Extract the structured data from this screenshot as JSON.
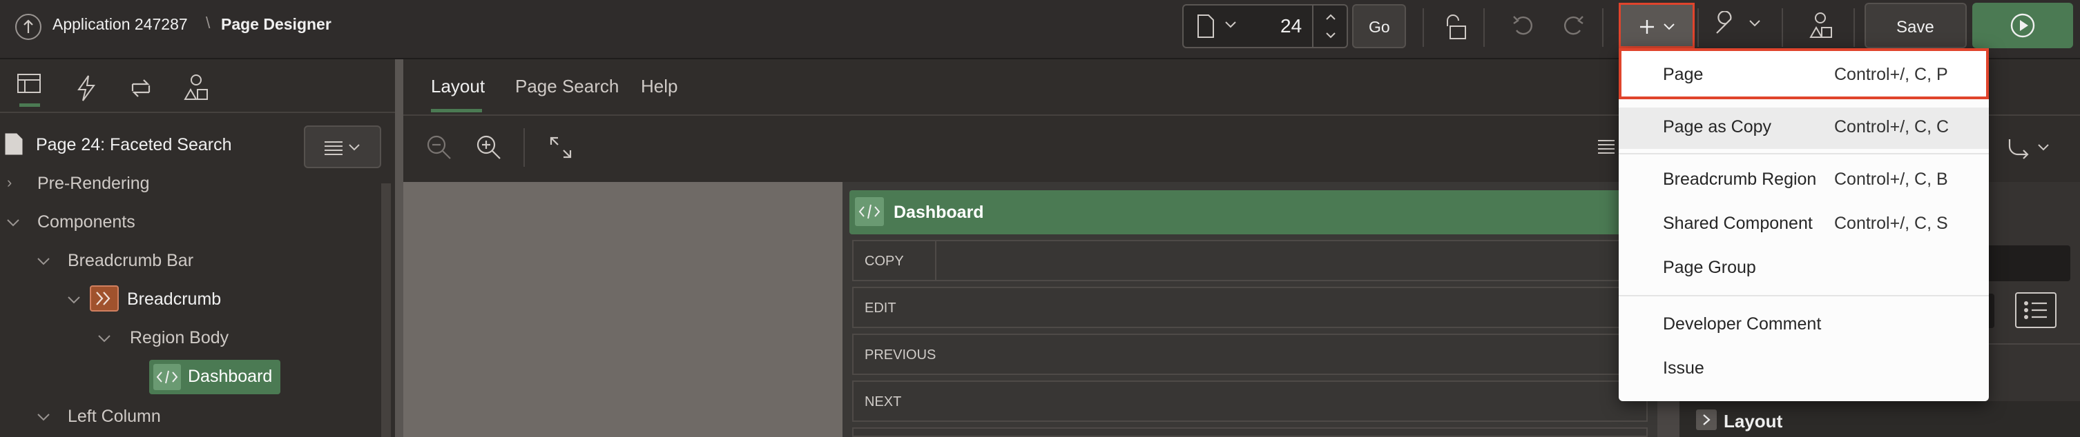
{
  "toolbar": {
    "app_title": "Application 247287",
    "separator": "\\",
    "page_designer": "Page Designer",
    "page_number": "24",
    "go_label": "Go",
    "save_label": "Save"
  },
  "left": {
    "page_title": "Page 24: Faceted Search",
    "tree": {
      "pre_rendering": "Pre-Rendering",
      "components": "Components",
      "breadcrumb_bar": "Breadcrumb Bar",
      "breadcrumb": "Breadcrumb",
      "region_body": "Region Body",
      "dashboard": "Dashboard",
      "left_column": "Left Column"
    }
  },
  "center": {
    "tabs": [
      "Layout",
      "Page Search",
      "Help"
    ],
    "region_title": "Dashboard",
    "buttons": [
      "COPY",
      "EDIT",
      "PREVIOUS",
      "NEXT"
    ]
  },
  "right": {
    "layout_label": "Layout"
  },
  "create_menu": {
    "items": [
      {
        "label": "Page",
        "shortcut": "Control+/, C, P"
      },
      {
        "label": "Page as Copy",
        "shortcut": "Control+/, C, C"
      },
      {
        "label": "Breadcrumb Region",
        "shortcut": "Control+/, C, B"
      },
      {
        "label": "Shared Component",
        "shortcut": "Control+/, C, S"
      },
      {
        "label": "Page Group",
        "shortcut": ""
      },
      {
        "label": "Developer Comment",
        "shortcut": ""
      },
      {
        "label": "Issue",
        "shortcut": ""
      }
    ]
  },
  "colors": {
    "accent_green": "#4b7a53",
    "highlight_red": "#e0442c",
    "breadcrumb_icon": "#a0522d"
  }
}
